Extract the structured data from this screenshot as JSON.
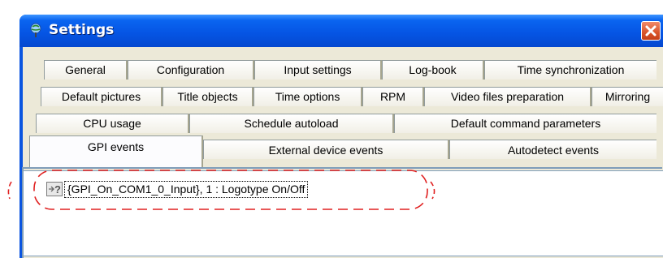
{
  "window": {
    "title": "Settings",
    "title_icon": "globe-pin-icon",
    "close_icon": "close-icon"
  },
  "tabs": {
    "row1": [
      "General",
      "Configuration",
      "Input settings",
      "Log-book",
      "Time synchronization"
    ],
    "row2": [
      "Default pictures",
      "Title objects",
      "Time options",
      "RPM",
      "Video files preparation",
      "Mirroring"
    ],
    "row3": [
      "CPU usage",
      "Schedule autoload",
      "Default command parameters"
    ],
    "row4": [
      "GPI events",
      "External device events",
      "Autodetect events"
    ],
    "selected": "GPI events"
  },
  "events_list": {
    "items": [
      {
        "icon": "unknown-event-icon",
        "label": "{GPI_On_COM1_0_Input}, 1 : Logotype On/Off"
      }
    ]
  },
  "annotation": {
    "color": "#e02020",
    "style": "dashed-rounded-rectangle"
  }
}
